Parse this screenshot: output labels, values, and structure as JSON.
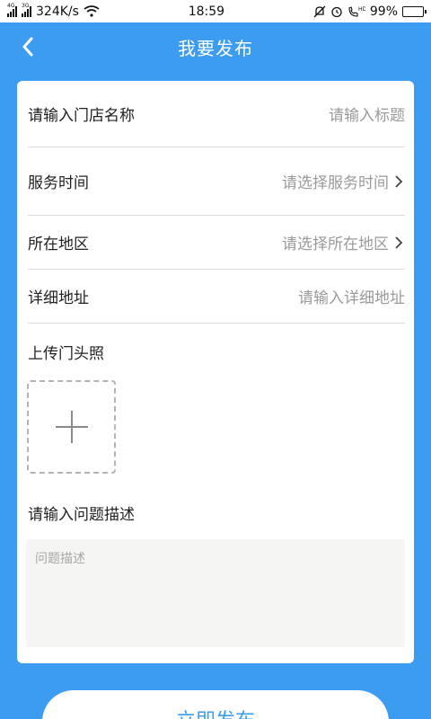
{
  "status_bar": {
    "network_speed": "324K/s",
    "signal1_tag": "4G",
    "signal2_tag": "3G",
    "time": "18:59",
    "battery": "99%",
    "battery_level": 0.99,
    "icons": [
      "wifi-icon",
      "mute-icon",
      "alarm-icon",
      "hd-call-icon",
      "battery-icon"
    ]
  },
  "header": {
    "title": "我要发布",
    "back_icon": "back-chevron-icon"
  },
  "form": {
    "store_name": {
      "label": "请输入门店名称",
      "placeholder": "请输入标题"
    },
    "service_time": {
      "label": "服务时间",
      "value": "请选择服务时间"
    },
    "region": {
      "label": "所在地区",
      "value": "请选择所在地区"
    },
    "address": {
      "label": "详细地址",
      "placeholder": "请输入详细地址"
    },
    "photo": {
      "label": "上传门头照",
      "add_icon": "plus-icon"
    },
    "description": {
      "label": "请输入问题描述",
      "placeholder": "问题描述"
    }
  },
  "submit": {
    "label": "立即发布"
  },
  "colors": {
    "primary": "#3c9cf0",
    "card": "#ffffff",
    "input_bg": "#f5f5f3",
    "placeholder": "#9a9a9a"
  }
}
